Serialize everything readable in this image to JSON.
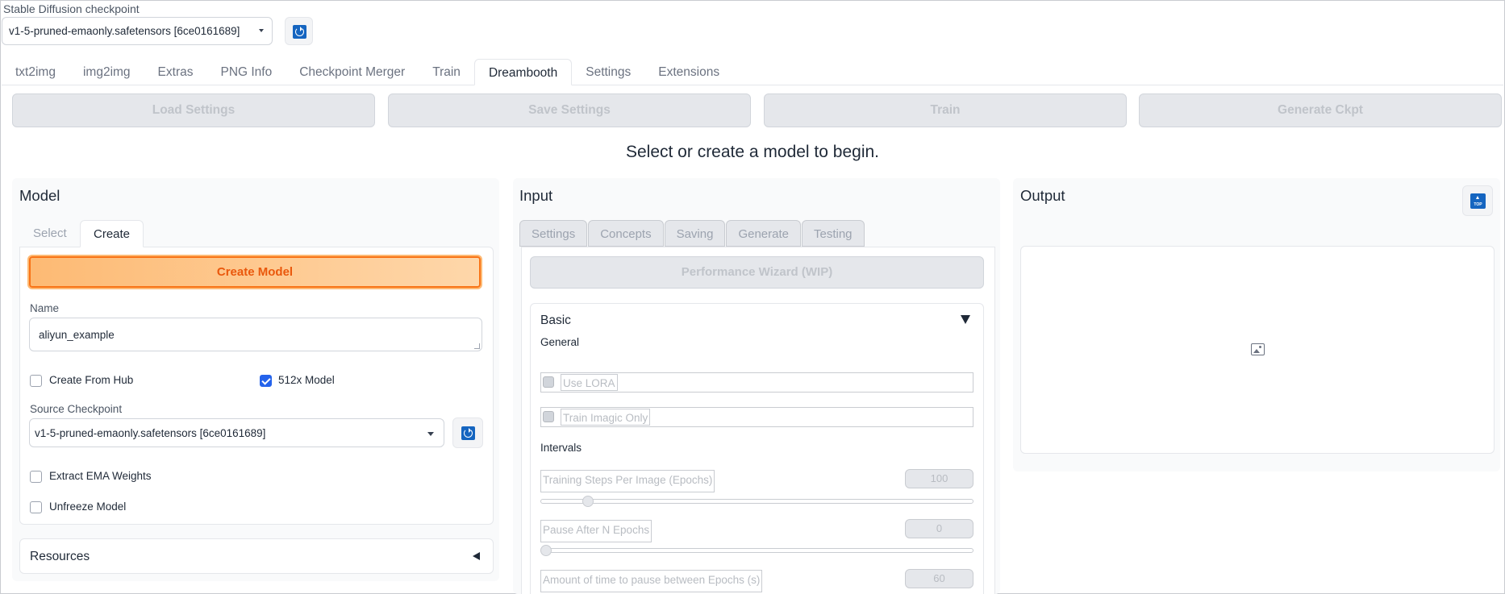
{
  "checkpoint": {
    "label": "Stable Diffusion checkpoint",
    "selected": "v1-5-pruned-emaonly.safetensors [6ce0161689]"
  },
  "main_tabs": [
    "txt2img",
    "img2img",
    "Extras",
    "PNG Info",
    "Checkpoint Merger",
    "Train",
    "Dreambooth",
    "Settings",
    "Extensions"
  ],
  "main_tabs_active": "Dreambooth",
  "actions": {
    "load": "Load Settings",
    "save": "Save Settings",
    "train": "Train",
    "generate": "Generate Ckpt"
  },
  "info_text": "Select or create a model to begin.",
  "model": {
    "title": "Model",
    "tabs": {
      "select": "Select",
      "create": "Create"
    },
    "create_button": "Create Model",
    "name_label": "Name",
    "name_value": "aliyun_example",
    "create_from_hub": {
      "label": "Create From Hub",
      "checked": false
    },
    "model_512": {
      "label": "512x Model",
      "checked": true
    },
    "source_label": "Source Checkpoint",
    "source_value": "v1-5-pruned-emaonly.safetensors [6ce0161689]",
    "extract_ema": {
      "label": "Extract EMA Weights",
      "checked": false
    },
    "unfreeze": {
      "label": "Unfreeze Model",
      "checked": false
    },
    "resources": "Resources"
  },
  "input": {
    "title": "Input",
    "tabs": [
      "Settings",
      "Concepts",
      "Saving",
      "Generate",
      "Testing"
    ],
    "wizard_button": "Performance Wizard (WIP)",
    "basic_title": "Basic",
    "general_label": "General",
    "use_lora": "Use LORA",
    "train_imagic": "Train Imagic Only",
    "intervals_label": "Intervals",
    "sliders": [
      {
        "label": "Training Steps Per Image (Epochs)",
        "value": "100",
        "fraction": 0.1
      },
      {
        "label": "Pause After N Epochs",
        "value": "0",
        "fraction": 0.0
      },
      {
        "label": "Amount of time to pause between Epochs (s)",
        "value": "60",
        "fraction": 0.0
      }
    ]
  },
  "output": {
    "title": "Output",
    "top_icon": "TOP"
  },
  "icons": {
    "refresh": "refresh-icon",
    "image_placeholder": "image-icon",
    "scroll_top": "scroll-top-icon"
  },
  "colors": {
    "accent": "#f97316",
    "primary_blue": "#1565c0",
    "checkbox_blue": "#2563eb"
  }
}
